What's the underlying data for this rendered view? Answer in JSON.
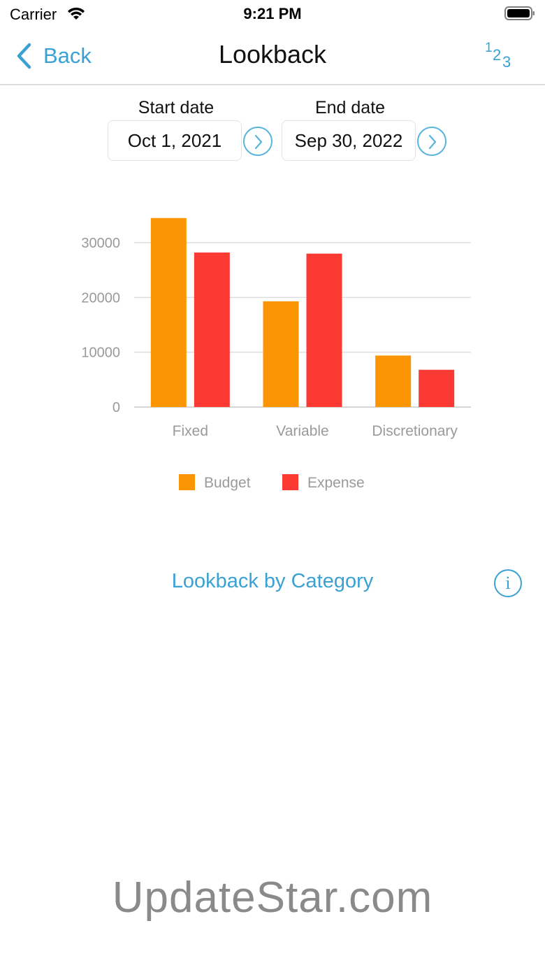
{
  "status": {
    "carrier": "Carrier",
    "time": "9:21 PM"
  },
  "nav": {
    "back_label": "Back",
    "title": "Lookback",
    "num_icon": [
      "1",
      "2",
      "3"
    ]
  },
  "dates": {
    "start_label": "Start date",
    "start_value": "Oct 1, 2021",
    "end_label": "End date",
    "end_value": "Sep 30, 2022"
  },
  "chart_data": {
    "type": "bar",
    "categories": [
      "Fixed",
      "Variable",
      "Discretionary"
    ],
    "series": [
      {
        "name": "Budget",
        "color": "#fb9504",
        "values": [
          34500,
          19300,
          9400
        ]
      },
      {
        "name": "Expense",
        "color": "#fc3a34",
        "values": [
          28200,
          28000,
          6800
        ]
      }
    ],
    "yticks": [
      0,
      10000,
      20000,
      30000
    ],
    "ylim": [
      0,
      36000
    ],
    "grid": true,
    "legend": "bottom"
  },
  "category_link": "Lookback by Category",
  "watermark": "UpdateStar.com",
  "colors": {
    "accent": "#3aa1d3"
  }
}
